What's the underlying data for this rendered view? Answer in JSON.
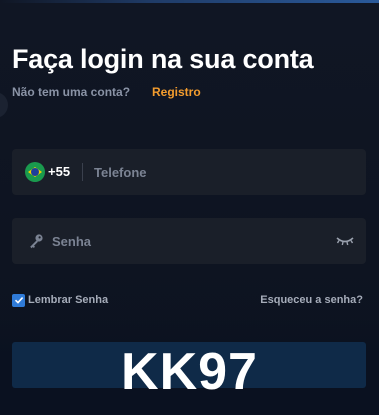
{
  "header": {
    "title": "Faça login na sua conta",
    "subtitle": "Não tem uma conta?",
    "register_link": "Registro"
  },
  "phone_field": {
    "country_flag": "brazil-flag-icon",
    "country_code": "+55",
    "placeholder": "Telefone",
    "value": ""
  },
  "password_field": {
    "icon": "key-icon",
    "placeholder": "Senha",
    "value": "",
    "toggle_icon": "eye-closed-icon"
  },
  "options": {
    "remember_label": "Lembrar Senha",
    "remember_checked": true,
    "forgot_link": "Esqueceu a senha?"
  },
  "watermark": "KK97",
  "colors": {
    "background": "#0f1420",
    "field": "#1a1f29",
    "accent": "#f39c2e",
    "checkbox": "#2f7bd8",
    "button": "#0f2a48"
  }
}
